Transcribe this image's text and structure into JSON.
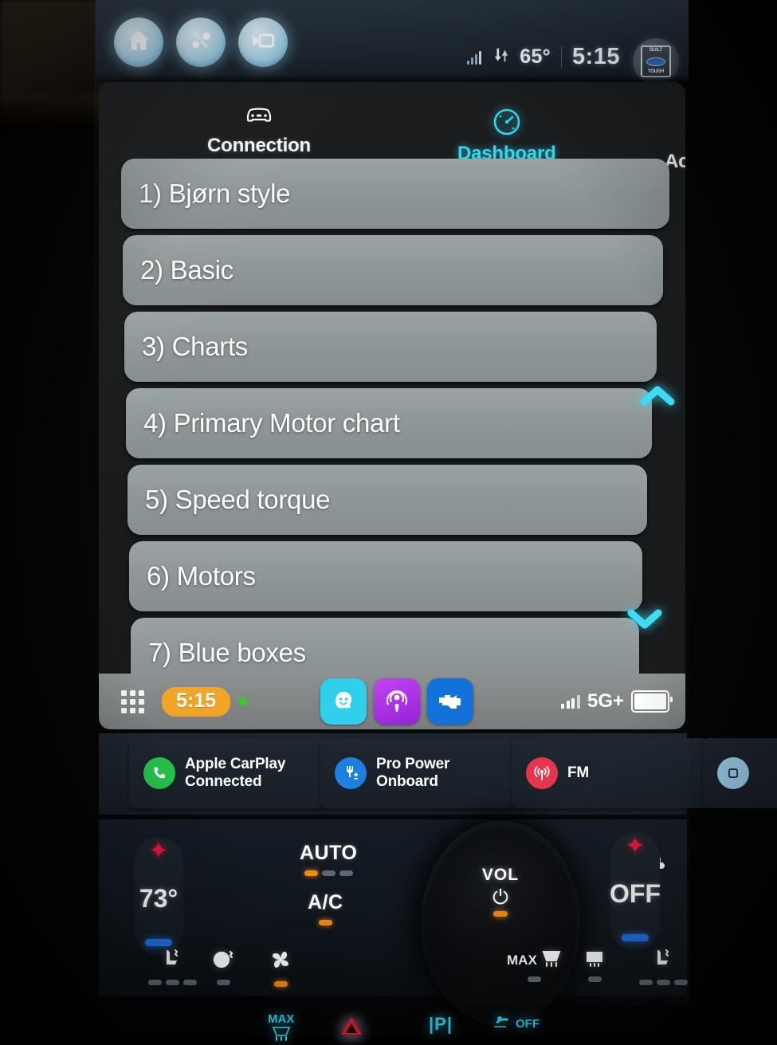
{
  "sync_bar": {
    "buttons": [
      {
        "name": "home",
        "icon": "home-icon"
      },
      {
        "name": "apps",
        "icon": "apps-connect-icon"
      },
      {
        "name": "projection",
        "icon": "projection-camera-icon"
      }
    ],
    "status": {
      "signal_icon": "cellular-signal-icon",
      "data_icon": "data-transfer-icon",
      "temperature": "65°",
      "clock": "5:15",
      "app_icon": "built-ford-tough-icon"
    }
  },
  "carplay_app": {
    "tabs": [
      {
        "label": "Connection",
        "icon": "car-icon",
        "active": false
      },
      {
        "label": "Dashboard",
        "icon": "gauge-icon",
        "active": true
      },
      {
        "label": "Acceleration",
        "icon": "shifter-icon",
        "active": false
      }
    ],
    "list_items": [
      {
        "label": "1) Bjørn style"
      },
      {
        "label": "2) Basic"
      },
      {
        "label": "3) Charts"
      },
      {
        "label": "4) Primary Motor chart"
      },
      {
        "label": "5) Speed torque"
      },
      {
        "label": "6) Motors"
      },
      {
        "label": "7) Blue boxes"
      }
    ],
    "scroll": {
      "up_icon": "chevron-up-icon",
      "down_icon": "chevron-down-icon",
      "accent": "#3ddcf2"
    }
  },
  "dock": {
    "grid_icon": "app-grid-icon",
    "clock": "5:15",
    "clock_pill_color": "#f0a528",
    "recording_dot_color": "#3dc72b",
    "apps": [
      {
        "name": "waze",
        "icon": "waze-icon",
        "color": "#30d0ec"
      },
      {
        "name": "podcasts",
        "icon": "podcasts-icon",
        "color": "#a72ce0"
      },
      {
        "name": "obd-engine",
        "icon": "engine-icon",
        "color": "#1272d8"
      }
    ],
    "signal_icon": "cellular-signal-icon",
    "network": "5G+",
    "battery_icon": "battery-full-icon"
  },
  "cards": [
    {
      "title": "Apple CarPlay",
      "subtitle": "Connected",
      "icon": "phone-icon",
      "color": "#26c04b"
    },
    {
      "title": "Pro Power",
      "subtitle": "Onboard",
      "icon": "power-outlet-icon",
      "color": "#1d7fe0"
    },
    {
      "title": "FM",
      "subtitle": "",
      "icon": "broadcast-icon",
      "color": "#e4354c"
    },
    {
      "title": "",
      "subtitle": "",
      "icon": "media-icon",
      "color": "#9fd4ee"
    }
  ],
  "climate": {
    "driver": {
      "temperature": "73°",
      "plus_icon": "plus-icon",
      "minus_icon": "minus-icon",
      "plus_color": "#e8173a",
      "minus_color": "#1f72e8"
    },
    "passenger": {
      "temperature": "OFF",
      "plus_icon": "plus-icon",
      "minus_icon": "minus-icon",
      "plus_color": "#e8173a",
      "minus_color": "#1f72e8"
    },
    "auto": {
      "label": "AUTO",
      "segments": [
        true,
        false,
        false
      ]
    },
    "ac": {
      "label": "A/C",
      "segments": [
        true
      ]
    },
    "passenger_airflow_icon": "seat-airflow-icon",
    "volume_knob": {
      "label": "VOL",
      "power_icon": "power-icon",
      "indicator_color": "#f08a15"
    },
    "bottom_icons": [
      {
        "name": "heated-seat-left",
        "icon": "heated-seat-icon",
        "label": "",
        "segments": [
          false,
          false,
          false
        ]
      },
      {
        "name": "heated-steering-wheel",
        "icon": "steering-wheel-icon",
        "label": "",
        "segments": [
          false
        ]
      },
      {
        "name": "fan-speed",
        "icon": "fan-icon",
        "label": "",
        "segments": [
          true
        ]
      },
      {
        "name": "max-defrost",
        "icon": "defrost-front-icon",
        "label": "MAX",
        "segments": [
          false
        ]
      },
      {
        "name": "rear-defrost",
        "icon": "defrost-rear-icon",
        "label": "",
        "segments": [
          false
        ]
      },
      {
        "name": "heated-seat-right",
        "icon": "heated-seat-icon",
        "label": "",
        "segments": [
          false,
          false,
          false
        ]
      }
    ]
  },
  "hardware_buttons": [
    {
      "name": "max-defrost",
      "label": "MAX",
      "icon": "defrost-front-icon",
      "color": "#2fd3ef"
    },
    {
      "name": "hazard-lights",
      "label": "",
      "icon": "hazard-triangle-icon",
      "color": "#e51b2e"
    },
    {
      "name": "electronic-parking-brake",
      "label": "|P|",
      "icon": "park-brake-icon",
      "color": "#2fd3ef"
    },
    {
      "name": "traction-control-off",
      "label": "OFF",
      "icon": "traction-control-icon",
      "color": "#2fd3ef"
    }
  ]
}
